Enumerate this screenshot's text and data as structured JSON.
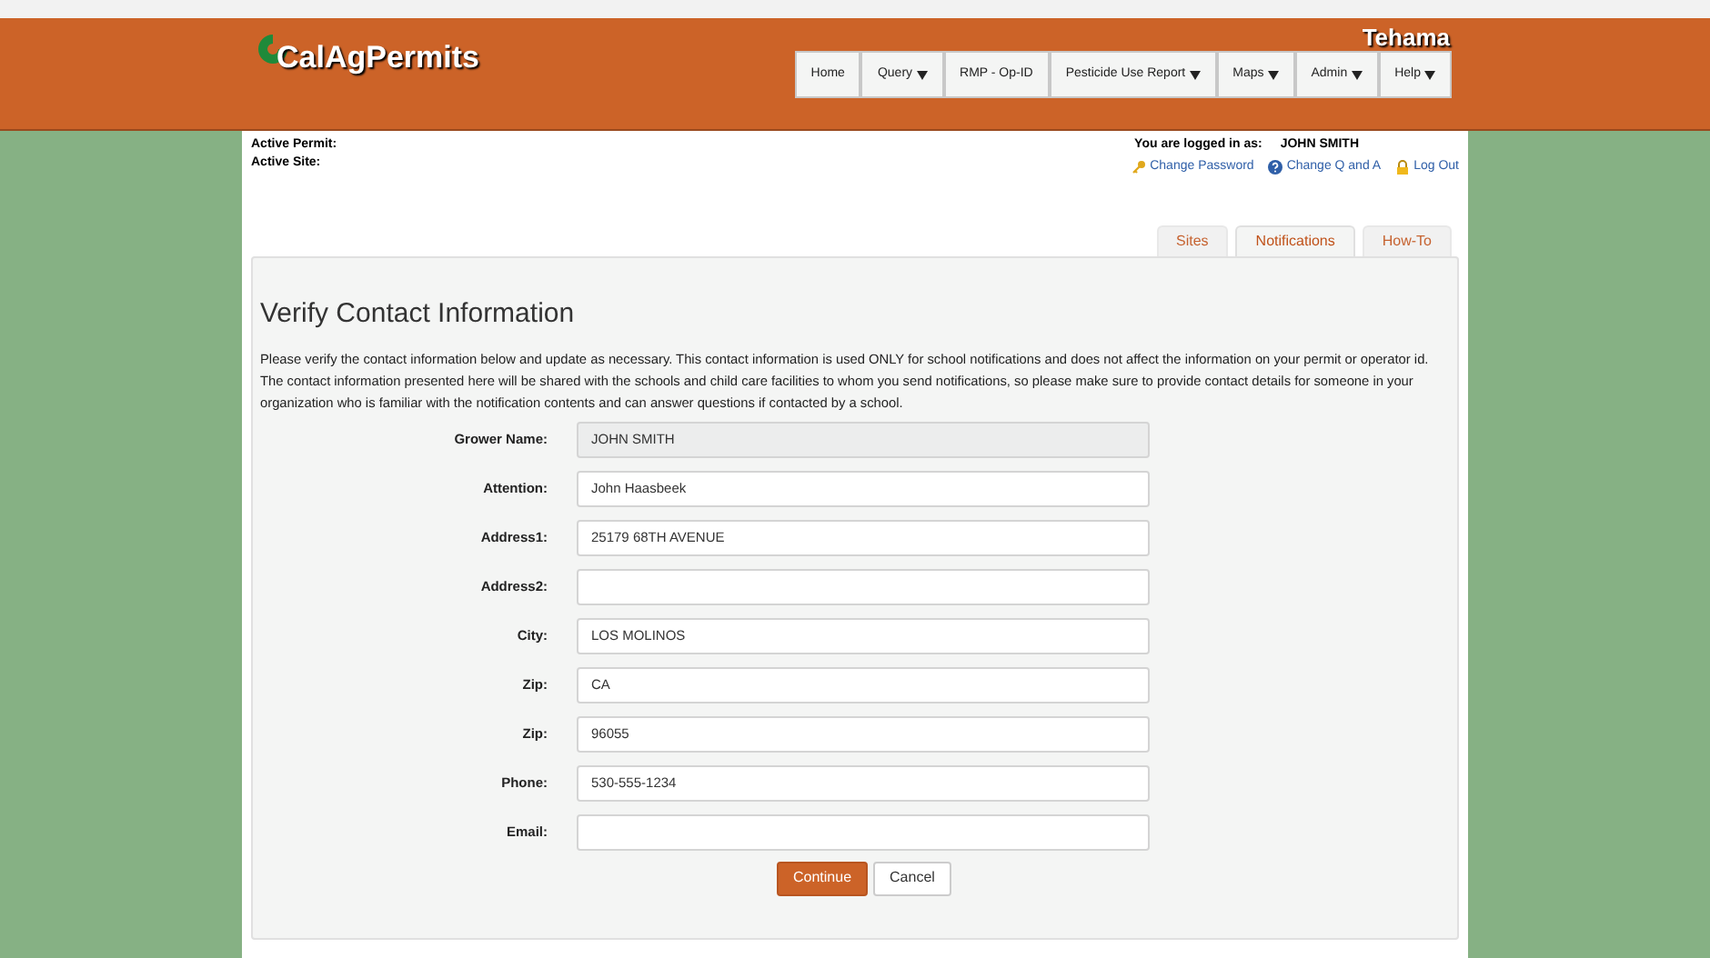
{
  "header": {
    "logo": "CalAgPermits",
    "county": "Tehama"
  },
  "nav": [
    {
      "label": "Home",
      "dropdown": false
    },
    {
      "label": "Query",
      "dropdown": true
    },
    {
      "label": "RMP - Op-ID",
      "dropdown": false
    },
    {
      "label": "Pesticide Use Report",
      "dropdown": true
    },
    {
      "label": "Maps",
      "dropdown": true
    },
    {
      "label": "Admin",
      "dropdown": true
    },
    {
      "label": "Help",
      "dropdown": true
    }
  ],
  "info": {
    "active_permit": "Active Permit:",
    "active_site": "Active Site:",
    "logged_in_label": "You are logged in as:",
    "user": "JOHN SMITH"
  },
  "account_links": [
    {
      "kind": "key",
      "label": "Change Password"
    },
    {
      "kind": "question",
      "label": "Change Q and A"
    },
    {
      "kind": "lock",
      "label": "Log Out"
    }
  ],
  "tabs": [
    {
      "label": "Sites",
      "selected": false
    },
    {
      "label": "Notifications",
      "selected": true
    },
    {
      "label": "How-To",
      "selected": false
    }
  ],
  "form": {
    "title": "Verify Contact Information",
    "description": "Please verify the contact information below and update as necessary. This contact information is used ONLY for school notifications and does not affect the information on your permit or operator id. The contact information presented here will be shared with the schools and child care facilities to whom you send notifications, so please make sure to provide contact details for someone in your organization who is familiar with the notification contents and can answer questions if contacted by a school.",
    "fields": [
      {
        "label": "Grower Name:",
        "value": "JOHN SMITH",
        "disabled": true
      },
      {
        "label": "Attention:",
        "value": "John Haasbeek",
        "disabled": false
      },
      {
        "label": "Address1:",
        "value": "25179 68TH AVENUE",
        "disabled": false
      },
      {
        "label": "Address2:",
        "disabled": false
      },
      {
        "label": "City:",
        "value": "LOS MOLINOS",
        "disabled": false
      },
      {
        "label": "Zip:",
        "value": "CA",
        "disabled": false
      },
      {
        "label": "Zip:",
        "value": "96055",
        "disabled": false
      },
      {
        "label": "Phone:",
        "value": "530-555-1234",
        "disabled": false
      },
      {
        "label": "Email:",
        "disabled": false
      }
    ],
    "buttons": [
      {
        "kind": "primary",
        "label": "Continue"
      },
      {
        "kind": "secondary",
        "label": "Cancel"
      }
    ]
  }
}
